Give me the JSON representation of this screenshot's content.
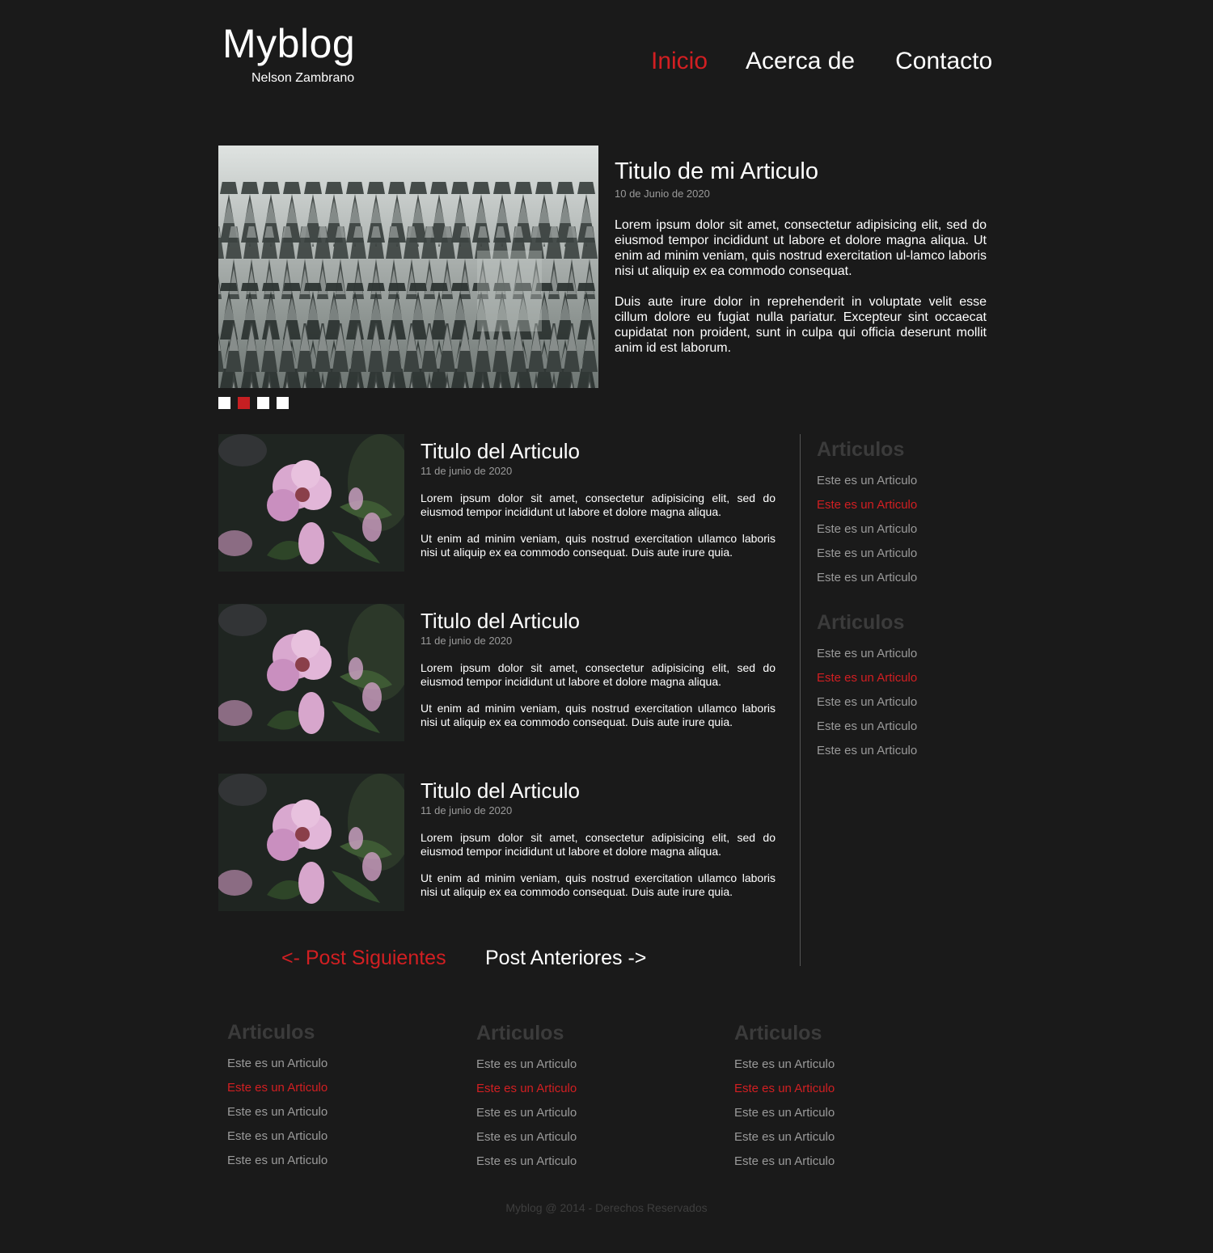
{
  "header": {
    "logo": "Myblog",
    "author": "Nelson Zambrano",
    "nav": [
      {
        "label": "Inicio",
        "active": true
      },
      {
        "label": "Acerca de",
        "active": false
      },
      {
        "label": "Contacto",
        "active": false
      }
    ]
  },
  "featured": {
    "title": "Titulo de mi Articulo",
    "date": "10 de Junio de 2020",
    "paragraphs": [
      "Lorem ipsum dolor sit amet, consectetur adipisicing elit, sed do eiusmod tempor incididunt ut labore et dolore magna aliqua. Ut enim ad minim veniam, quis nostrud exercitation ul-lamco laboris nisi ut aliquip ex ea commodo consequat.",
      "Duis aute irure dolor in reprehenderit in voluptate velit esse cillum dolore eu fugiat nulla pariatur. Excepteur sint occaecat cupidatat non proident, sunt in culpa qui officia deserunt mollit anim id est laborum."
    ],
    "slider_active_index": 1
  },
  "posts": [
    {
      "title": "Titulo del Articulo",
      "date": "11 de junio de 2020",
      "p1": "Lorem ipsum dolor sit amet, consectetur adipisicing elit, sed do eiusmod tempor incididunt ut labore et dolore magna aliqua.",
      "p2": "Ut enim ad minim veniam, quis nostrud exercitation ullamco laboris nisi ut aliquip ex ea commodo consequat. Duis aute irure quia."
    },
    {
      "title": "Titulo del Articulo",
      "date": "11 de junio de 2020",
      "p1": "Lorem ipsum dolor sit amet, consectetur adipisicing elit, sed do eiusmod tempor incididunt ut labore et dolore magna aliqua.",
      "p2": "Ut enim ad minim veniam, quis nostrud exercitation ullamco laboris nisi ut aliquip ex ea commodo consequat. Duis aute irure quia."
    },
    {
      "title": "Titulo del Articulo",
      "date": "11 de junio de 2020",
      "p1": "Lorem ipsum dolor sit amet, consectetur adipisicing elit, sed do eiusmod tempor incididunt ut labore et dolore magna aliqua.",
      "p2": "Ut enim ad minim veniam, quis nostrud exercitation ullamco laboris nisi ut aliquip ex ea commodo consequat. Duis aute irure quia."
    }
  ],
  "sidebar": [
    {
      "heading": "Articulos",
      "items": [
        "Este es un Articulo",
        "Este es un Articulo",
        "Este es un Articulo",
        "Este es un Articulo",
        "Este es un Articulo"
      ]
    },
    {
      "heading": "Articulos",
      "items": [
        "Este es un Articulo",
        "Este es un Articulo",
        "Este es un Articulo",
        "Este es un Articulo",
        "Este es un Articulo"
      ]
    }
  ],
  "pager": {
    "prev": "<- Post Siguientes",
    "next": "Post Anteriores ->"
  },
  "footer": {
    "columns": [
      {
        "heading": "Articulos",
        "items": [
          "Este es un Articulo",
          "Este es un Articulo",
          "Este es un Articulo",
          "Este es un Articulo",
          "Este es un Articulo"
        ]
      },
      {
        "heading": "Articulos",
        "items": [
          "Este es un Articulo",
          "Este es un Articulo",
          "Este es un Articulo",
          "Este es un Articulo",
          "Este es un Articulo"
        ]
      },
      {
        "heading": "Articulos",
        "items": [
          "Este es un Articulo",
          "Este es un Articulo",
          "Este es un Articulo",
          "Este es un Articulo",
          "Este es un Articulo"
        ]
      }
    ],
    "copyright": "Myblog @ 2014 - Derechos Reservados"
  },
  "colors": {
    "background": "#1a1a1a",
    "accent": "#d21f22",
    "muted_text": "#9a9a9a",
    "heading_dim": "#3b3b3b"
  }
}
